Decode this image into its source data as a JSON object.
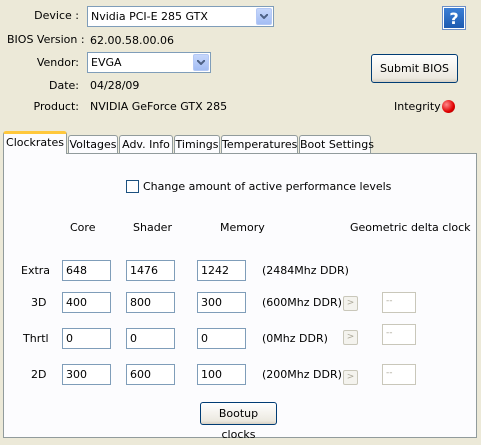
{
  "device": {
    "label": "Device :",
    "value": "Nvidia PCI-E 285 GTX"
  },
  "bios_version": {
    "label": "BIOS Version :",
    "value": "62.00.58.00.06"
  },
  "vendor": {
    "label": "Vendor:",
    "value": "EVGA"
  },
  "date": {
    "label": "Date:",
    "value": "04/28/09"
  },
  "product": {
    "label": "Product:",
    "value": "NVIDIA GeForce GTX 285"
  },
  "submit_bios": "Submit BIOS",
  "help_glyph": "?",
  "integrity": {
    "label": "Integrity :",
    "color": "#e00000"
  },
  "tabs": [
    {
      "label": "Clockrates"
    },
    {
      "label": "Voltages"
    },
    {
      "label": "Adv. Info"
    },
    {
      "label": "Timings"
    },
    {
      "label": "Temperatures"
    },
    {
      "label": "Boot Settings"
    }
  ],
  "clockrates": {
    "change_levels_label": "Change amount of active performance levels",
    "change_levels_checked": false,
    "columns": {
      "core": "Core",
      "shader": "Shader",
      "memory": "Memory",
      "delta": "Geometric delta clock"
    },
    "rows": [
      {
        "label": "Extra",
        "core": "648",
        "shader": "1476",
        "memory": "1242",
        "ddr": "(2484Mhz DDR)",
        "has_delta": false,
        "delta": ""
      },
      {
        "label": "3D",
        "core": "400",
        "shader": "800",
        "memory": "300",
        "ddr": "(600Mhz DDR)",
        "has_delta": true,
        "delta": "--"
      },
      {
        "label": "Thrtl",
        "core": "0",
        "shader": "0",
        "memory": "0",
        "ddr": "(0Mhz DDR)",
        "has_delta": true,
        "delta": "--"
      },
      {
        "label": "2D",
        "core": "300",
        "shader": "600",
        "memory": "100",
        "ddr": "(200Mhz DDR)",
        "has_delta": true,
        "delta": "--"
      }
    ],
    "arrow_glyph": ">",
    "bootup_button": "Bootup clocks"
  }
}
